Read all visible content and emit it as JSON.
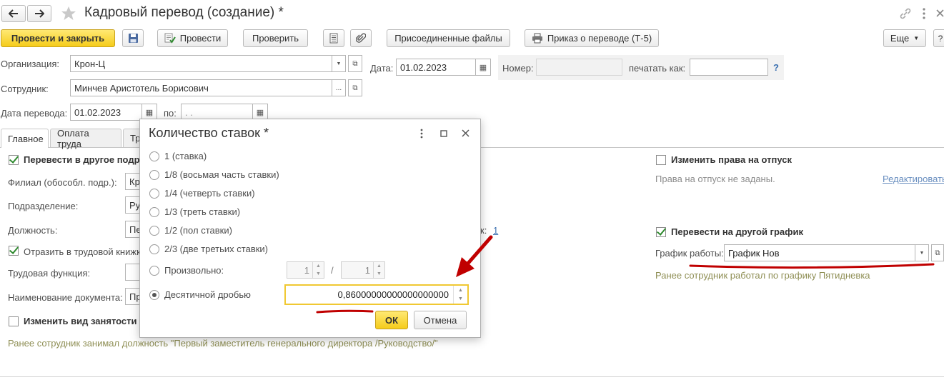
{
  "window": {
    "title": "Кадровый перевод (создание) *"
  },
  "toolbar": {
    "post_close": "Провести и закрыть",
    "post": "Провести",
    "check": "Проверить",
    "attached_files": "Присоединенные файлы",
    "print_order": "Приказ о переводе (Т-5)",
    "more": "Еще"
  },
  "header": {
    "org_label": "Организация:",
    "org_value": "Крон-Ц",
    "date_label": "Дата:",
    "date_value": "01.02.2023",
    "number_label": "Номер:",
    "number_value": "",
    "print_as_label": "печатать как:",
    "print_as_value": "",
    "help": "?",
    "employee_label": "Сотрудник:",
    "employee_value": "Минчев Аристотель Борисович",
    "transfer_date_label": "Дата перевода:",
    "transfer_date_value": "01.02.2023",
    "to_label": "по:",
    "to_value": " .  .    "
  },
  "tabs": [
    {
      "label": "Главное",
      "active": true
    },
    {
      "label": "Оплата труда",
      "active": false
    },
    {
      "label": "Тр",
      "active": false
    }
  ],
  "main": {
    "transfer_dept_label": "Перевести в другое подр",
    "transfer_dept_checked": true,
    "branch_label": "Филиал (обособл. подр.):",
    "branch_value": "Кр",
    "division_label": "Подразделение:",
    "division_value": "Ру",
    "position_label": "Должность:",
    "position_value": "Пе",
    "rates_label_tail": "к:",
    "rates_link": "1",
    "reflect_label": "Отразить в трудовой книжк",
    "reflect_checked": true,
    "labor_function_label": "Трудовая функция:",
    "labor_function_value": "",
    "doc_name_label": "Наименование документа:",
    "doc_name_value": "Пр",
    "change_employment_label": "Изменить вид занятости",
    "change_employment_checked": false,
    "previous_position_note": "Ранее сотрудник занимал должность \"Первый заместитель генерального директора /Руководство/\""
  },
  "right": {
    "vacation_label": "Изменить права на отпуск",
    "vacation_checked": false,
    "vacation_note": "Права на отпуск не заданы.",
    "edit_link": "Редактировать",
    "schedule_label": "Перевести на другой график",
    "schedule_checked": true,
    "work_schedule_label": "График работы:",
    "work_schedule_value": "График Нов",
    "schedule_note": "Ранее сотрудник работал по графику Пятидневка"
  },
  "dialog": {
    "title": "Количество ставок *",
    "options": [
      {
        "label": "1 (ставка)",
        "selected": false
      },
      {
        "label": "1/8 (восьмая часть ставки)",
        "selected": false
      },
      {
        "label": "1/4 (четверть ставки)",
        "selected": false
      },
      {
        "label": "1/3 (треть ставки)",
        "selected": false
      },
      {
        "label": "1/2 (пол ставки)",
        "selected": false
      },
      {
        "label": "2/3 (две третьих ставки)",
        "selected": false
      },
      {
        "label": "Произвольно:",
        "selected": false
      },
      {
        "label": "Десятичной дробью",
        "selected": true
      }
    ],
    "numerator": "1",
    "slash": "/",
    "denominator": "1",
    "decimal_value": "0,86000000000000000000",
    "ok": "ОК",
    "cancel": "Отмена"
  },
  "colors": {
    "accent_yellow": "#f5cc1b",
    "annotation_red": "#c00000",
    "link_blue": "#3a6fb0",
    "check_green": "#2f8a2f"
  }
}
